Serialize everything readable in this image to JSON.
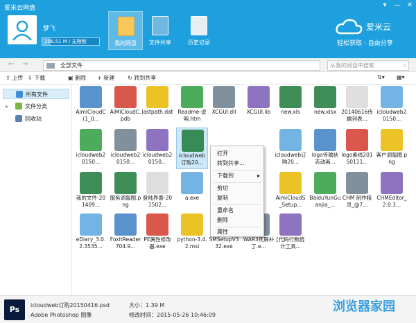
{
  "window": {
    "title": "爱米云网盘",
    "controls": [
      "▾",
      "—",
      "✕"
    ]
  },
  "user": {
    "name": "梦飞",
    "quota": "206.51 M / 无限制",
    "quota_fraction": 0.15
  },
  "nav": [
    {
      "label": "我的网盘",
      "active": true,
      "icon": "folder-icon"
    },
    {
      "label": "文件共享",
      "active": false,
      "icon": "share-icon"
    },
    {
      "label": "历史记录",
      "active": false,
      "icon": "clock-icon"
    }
  ],
  "brand": {
    "name": "爱米云",
    "slogan": "轻松获取 · 自由分享"
  },
  "address": {
    "back": "←",
    "forward": "→",
    "path": "全部文件",
    "search_placeholder": "从我的网盘中搜索"
  },
  "toolbar": [
    {
      "label": "上传",
      "icon": "upload-icon"
    },
    {
      "label": "下载",
      "icon": "download-icon"
    },
    {
      "label": "删除",
      "icon": "delete-icon"
    },
    {
      "label": "新建",
      "icon": "plus-icon"
    },
    {
      "label": "转到共享",
      "icon": "share-arrow-icon"
    }
  ],
  "sidebar": [
    {
      "label": "所有文件",
      "active": true
    },
    {
      "label": "文件分类",
      "active": false
    },
    {
      "label": "回收站",
      "active": false
    }
  ],
  "files": [
    [
      "AimiCloudC(1_0...",
      "AiMiCloudC.pdb",
      "lastpath.dat",
      "Readme-说明.htm",
      "XCGUI.dll",
      "XCGUI.lib",
      "new.xls",
      "new.xlsx",
      "20140616传輸列表...",
      "icloudweb20150..."
    ],
    [
      "icloudweb20150...",
      "icloudweb20150...",
      "icloudweb20150...",
      "icloudweb订购20...",
      "",
      "",
      "icloudweb订购20...",
      "logo传输状态动画...",
      "logo素线20150111...",
      "客户调匐图.png"
    ],
    [
      "我的文件-201409...",
      "服务调匐图.png",
      "登陆界面-201502...",
      "a.exe",
      "",
      "",
      "AimiCloudS_Setup...",
      "BaiduYunGuanjia_...",
      "CHM 制作精灵_@7...",
      "CHMEditor_2.0.3..."
    ],
    [
      "eDiary_3.0.2.3535...",
      "FoxitReader704.9...",
      "PE属性修改器.exe",
      "python-3.4.2.msi",
      "SMSetupV332.exe",
      "WAR3死屏补丁.e...",
      "[代码行数统计工具...",
      "",
      "",
      ""
    ]
  ],
  "context_menu": [
    "打开",
    "转到共享...",
    "下载到",
    "剪切",
    "复制",
    "重命名",
    "删除",
    "属性"
  ],
  "status": {
    "icon_text": "Ps",
    "filename": "icloudweb订购20150416.psd",
    "type": "Adobe Photoshop 图像",
    "size": "大小：1.39 M",
    "modified": "修改时间：2015-05-26 10:46:09"
  },
  "watermark": "浏览器家园",
  "colors": {
    "titlebar": "#1ea0de",
    "selection": "#cde8f8"
  }
}
